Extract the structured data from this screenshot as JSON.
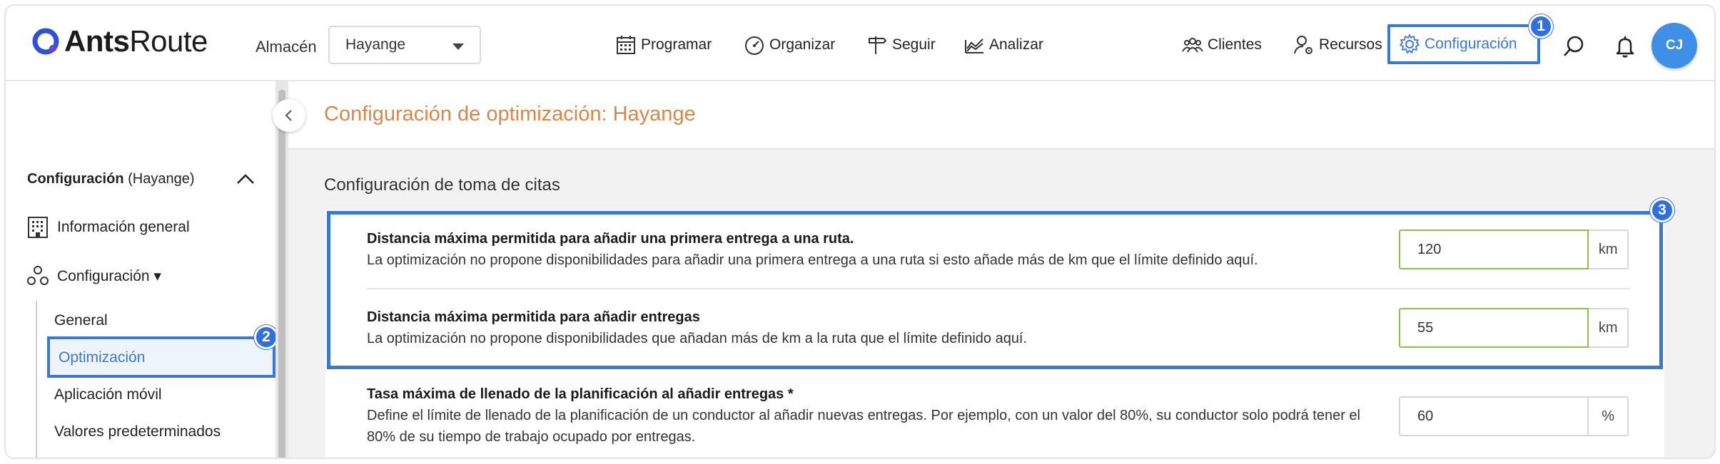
{
  "header": {
    "logo_bold": "Ants",
    "logo_light": "Route",
    "warehouse_label": "Almacén",
    "warehouse_value": "Hayange",
    "nav": [
      {
        "label": "Programar",
        "icon": "calendar-icon"
      },
      {
        "label": "Organizar",
        "icon": "dashboard-icon"
      },
      {
        "label": "Seguir",
        "icon": "signpost-icon"
      },
      {
        "label": "Analizar",
        "icon": "chart-icon"
      }
    ],
    "right_nav": [
      {
        "label": "Clientes",
        "icon": "users-icon"
      },
      {
        "label": "Recursos",
        "icon": "user-gear-icon"
      },
      {
        "label": "Configuración",
        "icon": "gear-icon",
        "active": true
      }
    ],
    "avatar_initials": "CJ",
    "accent_color": "#3a78d8"
  },
  "badges": {
    "b1": "1",
    "b2": "2",
    "b3": "3"
  },
  "sidebar": {
    "heading_bold": "Configuración",
    "heading_suffix": "(Hayange)",
    "items": [
      {
        "label": "Información general",
        "icon": "building-icon"
      },
      {
        "label": "Configuración ▾",
        "icon": "nodes-icon"
      }
    ],
    "sub_items": [
      "General",
      "Optimización",
      "Aplicación móvil",
      "Valores predeterminados"
    ],
    "active_sub": "Optimización"
  },
  "main": {
    "page_title": "Configuración de optimización: Hayange",
    "section_title": "Configuración de toma de citas",
    "rows": [
      {
        "title": "Distancia máxima permitida para añadir una primera entrega a una ruta.",
        "desc": "La optimización no propone disponibilidades para añadir una primera entrega a una ruta si esto añade más de km que el límite definido aquí.",
        "value": "120",
        "unit": "km"
      },
      {
        "title": "Distancia máxima permitida para añadir entregas",
        "desc": "La optimización no propone disponibilidades que añadan más de km a la ruta que el límite definido aquí.",
        "value": "55",
        "unit": "km"
      },
      {
        "title": "Tasa máxima de llenado de la planificación al añadir entregas *",
        "desc": "Define el límite de llenado de la planificación de un conductor al añadir nuevas entregas. Por ejemplo, con un valor del 80%, su conductor solo podrá tener el 80% de su tiempo de trabajo ocupado por entregas.",
        "value": "60",
        "unit": "%"
      }
    ]
  }
}
